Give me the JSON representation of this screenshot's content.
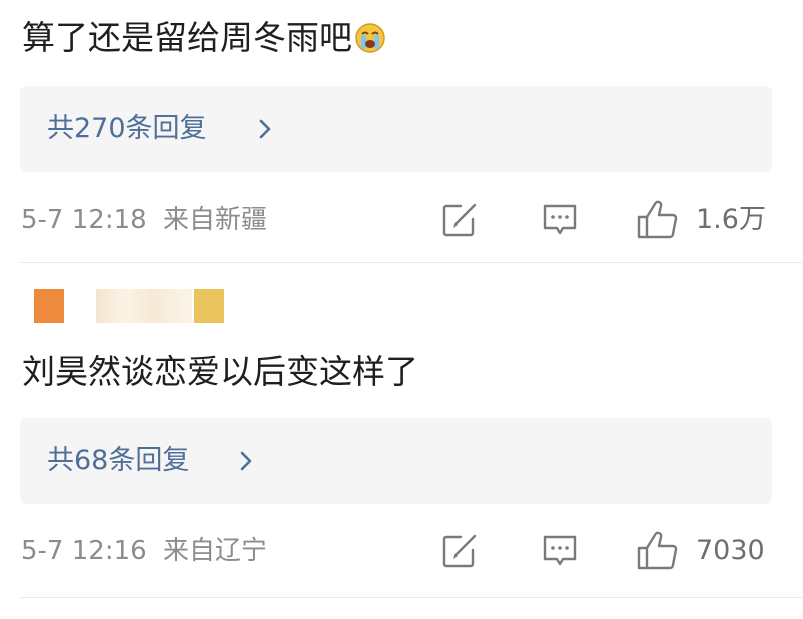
{
  "comments": [
    {
      "text": "算了还是留给周冬雨吧",
      "emoji": "crying-face-icon",
      "replies_label": "共270条回复",
      "timestamp": "5-7 12:18",
      "location": "来自新疆",
      "likes": "1.6万"
    },
    {
      "username": "",
      "text": "刘昊然谈恋爱以后变这样了",
      "replies_label": "共68条回复",
      "timestamp": "5-7 12:16",
      "location": "来自辽宁",
      "likes": "7030"
    }
  ],
  "icons": {
    "share": "share-icon",
    "comment": "comment-icon",
    "like": "thumbs-up-icon",
    "chevron": "chevron-right-icon"
  },
  "colors": {
    "link": "#4f6f99",
    "meta": "#8c8c8c",
    "reply_bg": "#f5f5f5",
    "avatar_orange": "#ee8a3e",
    "avatar_yellow": "#e9c45c"
  }
}
